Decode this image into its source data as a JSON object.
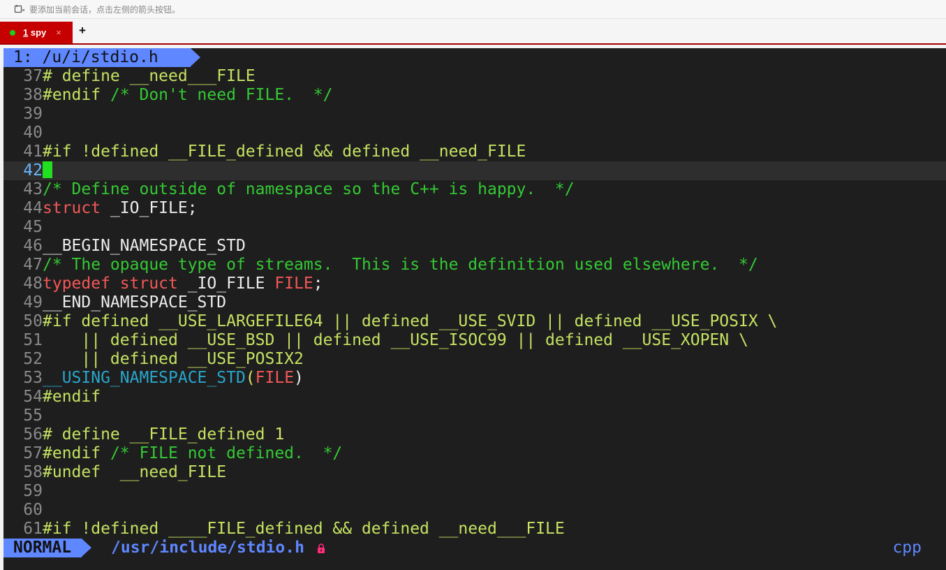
{
  "hint": {
    "icon": "add-session-icon",
    "text": "要添加当前会话，点击左侧的箭头按钮。"
  },
  "tab": {
    "number": "1",
    "name": " spy",
    "close_icon": "×",
    "status_color": "#19d019"
  },
  "add_tab": "+",
  "editor": {
    "buffer_label": "1: /u/i/stdio.h",
    "lines": [
      {
        "n": "37",
        "segs": [
          {
            "c": "pp",
            "t": "# define __need___FILE"
          }
        ]
      },
      {
        "n": "38",
        "segs": [
          {
            "c": "pp",
            "t": "#endif "
          },
          {
            "c": "cm",
            "t": "/* Don't need FILE.  */"
          }
        ]
      },
      {
        "n": "39",
        "segs": []
      },
      {
        "n": "40",
        "segs": []
      },
      {
        "n": "41",
        "segs": [
          {
            "c": "pp",
            "t": "#if !defined __FILE_defined && defined __need_FILE"
          }
        ]
      },
      {
        "n": "42",
        "cursor": true,
        "segs": []
      },
      {
        "n": "43",
        "segs": [
          {
            "c": "cm",
            "t": "/* Define outside of namespace so the C++ is happy.  */"
          }
        ]
      },
      {
        "n": "44",
        "segs": [
          {
            "c": "kw",
            "t": "struct"
          },
          {
            "c": "",
            "t": " _IO_FILE;"
          }
        ]
      },
      {
        "n": "45",
        "segs": []
      },
      {
        "n": "46",
        "segs": [
          {
            "c": "",
            "t": "__BEGIN_NAMESPACE_STD"
          }
        ]
      },
      {
        "n": "47",
        "segs": [
          {
            "c": "cm",
            "t": "/* The opaque type of streams.  This is the definition used elsewhere.  */"
          }
        ]
      },
      {
        "n": "48",
        "segs": [
          {
            "c": "kw",
            "t": "typedef"
          },
          {
            "c": "",
            "t": " "
          },
          {
            "c": "kw",
            "t": "struct"
          },
          {
            "c": "",
            "t": " _IO_FILE "
          },
          {
            "c": "kw",
            "t": "FILE"
          },
          {
            "c": "",
            "t": ";"
          }
        ]
      },
      {
        "n": "49",
        "segs": [
          {
            "c": "",
            "t": "__END_NAMESPACE_STD"
          }
        ]
      },
      {
        "n": "50",
        "segs": [
          {
            "c": "pp",
            "t": "#if defined __USE_LARGEFILE64 || defined __USE_SVID || defined __USE_POSIX \\"
          }
        ]
      },
      {
        "n": "51",
        "segs": [
          {
            "c": "pp",
            "t": "    || defined __USE_BSD || defined __USE_ISOC99 || defined __USE_XOPEN \\"
          }
        ]
      },
      {
        "n": "52",
        "segs": [
          {
            "c": "pp",
            "t": "    || defined __USE_POSIX2"
          }
        ]
      },
      {
        "n": "53",
        "segs": [
          {
            "c": "fn",
            "t": "__USING_NAMESPACE_STD"
          },
          {
            "c": "nm",
            "t": "("
          },
          {
            "c": "kw",
            "t": "FILE"
          },
          {
            "c": "",
            "t": ")"
          }
        ]
      },
      {
        "n": "54",
        "segs": [
          {
            "c": "pp",
            "t": "#endif"
          }
        ]
      },
      {
        "n": "55",
        "segs": []
      },
      {
        "n": "56",
        "segs": [
          {
            "c": "pp",
            "t": "# define __FILE_defined "
          },
          {
            "c": "nm",
            "t": "1"
          }
        ]
      },
      {
        "n": "57",
        "segs": [
          {
            "c": "pp",
            "t": "#endif "
          },
          {
            "c": "cm",
            "t": "/* FILE not defined.  */"
          }
        ]
      },
      {
        "n": "58",
        "segs": [
          {
            "c": "pp",
            "t": "#undef  __need_FILE"
          }
        ]
      },
      {
        "n": "59",
        "segs": []
      },
      {
        "n": "60",
        "segs": []
      },
      {
        "n": "61",
        "segs": [
          {
            "c": "pp",
            "t": "#if !defined ____FILE_defined && defined __need___FILE"
          }
        ]
      }
    ],
    "status": {
      "mode": "NORMAL",
      "path": "/usr/include/stdio.h",
      "lock_icon": "lock-icon",
      "filetype": "cpp"
    },
    "colors": {
      "accent": "#5f87ff",
      "tab_red": "#c60000",
      "cursor": "#20e020"
    }
  }
}
